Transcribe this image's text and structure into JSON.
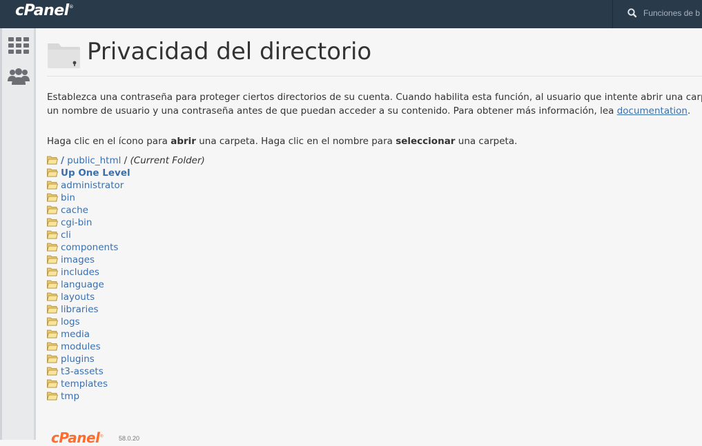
{
  "app": {
    "logo_text": "cPanel",
    "logo_mark": "®"
  },
  "search": {
    "placeholder": "Funciones de b"
  },
  "sidebar": {
    "items": [
      {
        "name": "grid-icon",
        "label": ""
      },
      {
        "name": "users-icon",
        "label": ""
      }
    ]
  },
  "page": {
    "title": "Privacidad del directorio",
    "description_line1": "Establezca una contraseña para proteger ciertos directorios de su cuenta. Cuando habilita esta función, al usuario que intente abrir una carpeta pr",
    "description_line2_pre": "un nombre de usuario y una contraseña antes de que puedan acceder a su contenido. Para obtener más información, lea ",
    "description_link": "documentation",
    "description_line2_post": ".",
    "instruction_pre": "Haga clic en el ícono para ",
    "instruction_bold1": "abrir",
    "instruction_mid": " una carpeta. Haga clic en el nombre para ",
    "instruction_bold2": "seleccionar",
    "instruction_post": " una carpeta."
  },
  "tree": {
    "root_slash": "/",
    "current_path": "public_html",
    "path_sep": " / ",
    "current_label": "(Current Folder)",
    "up_level": "Up One Level",
    "folders": [
      "administrator",
      "bin",
      "cache",
      "cgi-bin",
      "cli",
      "components",
      "images",
      "includes",
      "language",
      "layouts",
      "libraries",
      "logs",
      "media",
      "modules",
      "plugins",
      "t3-assets",
      "templates",
      "tmp"
    ]
  },
  "footer": {
    "logo_text": "cPanel",
    "logo_mark": "®",
    "version": "58.0.20"
  },
  "colors": {
    "topbar": "#293a4a",
    "link": "#3a6fae",
    "footer_logo": "#ff6c2c"
  }
}
